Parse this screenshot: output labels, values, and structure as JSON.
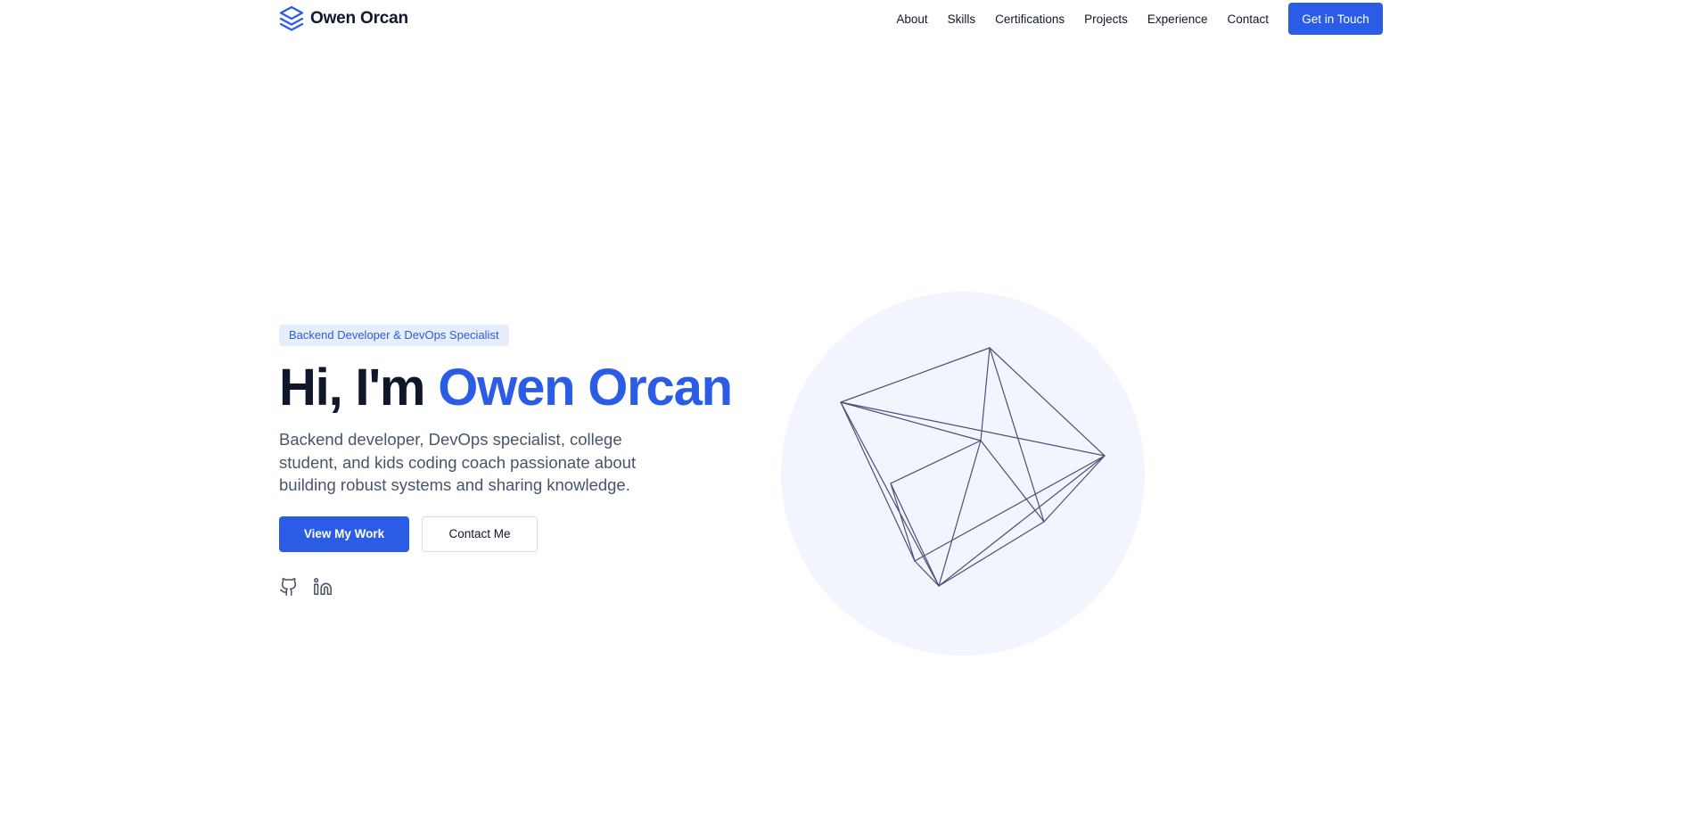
{
  "header": {
    "brand_name": "Owen Orcan",
    "brand_icon": "layers-icon",
    "nav": [
      {
        "label": "About"
      },
      {
        "label": "Skills"
      },
      {
        "label": "Certifications"
      },
      {
        "label": "Projects"
      },
      {
        "label": "Experience"
      },
      {
        "label": "Contact"
      }
    ],
    "cta_label": "Get in Touch"
  },
  "hero": {
    "badge": "Backend Developer & DevOps Specialist",
    "title_prefix": "Hi, I'm ",
    "title_name": "Owen Orcan",
    "description": "Backend developer, DevOps specialist, college student, and kids coding coach passionate about building robust systems and sharing knowledge.",
    "primary_button": "View My Work",
    "secondary_button": "Contact Me",
    "social": [
      {
        "icon": "github-icon"
      },
      {
        "icon": "linkedin-icon"
      }
    ],
    "illustration": "wireframe-polyhedron"
  },
  "colors": {
    "accent": "#2b5ce6",
    "text": "#0f172a",
    "muted": "#475569",
    "badge_bg": "#e6edfb",
    "art_circle": "#f2f5fd",
    "art_lines": "#4a4f78"
  }
}
